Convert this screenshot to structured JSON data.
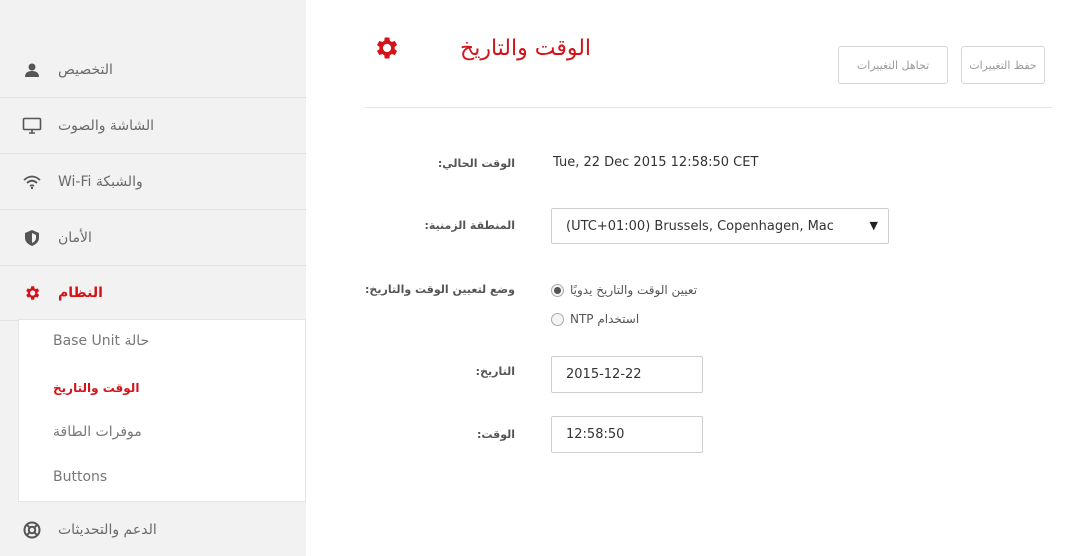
{
  "sidebar": {
    "items": [
      {
        "label": "التخصيص",
        "icon": "person-icon"
      },
      {
        "label": "الشاشة والصوت",
        "icon": "monitor-icon"
      },
      {
        "label": "Wi-Fi والشبكة",
        "icon": "wifi-icon"
      },
      {
        "label": "الأمان",
        "icon": "shield-icon"
      },
      {
        "label": "النظام",
        "icon": "gear-icon"
      },
      {
        "label": "الدعم والتحديثات",
        "icon": "lifebuoy-icon"
      }
    ],
    "submenu": [
      {
        "label": "Base Unit حالة"
      },
      {
        "label": "الوقت والتاريخ"
      },
      {
        "label": "موفرات الطاقة"
      },
      {
        "label": "Buttons"
      }
    ]
  },
  "main": {
    "title": "الوقت والتاريخ",
    "buttons": {
      "discard": "تجاهل التغييرات",
      "save": "حفظ التغييرات"
    },
    "current_time": {
      "label": ":الوقت الحالي",
      "value": "Tue, 22 Dec 2015 12:58:50 CET"
    },
    "timezone": {
      "label": ":المنطقة الزمنية",
      "value": "(UTC+01:00) Brussels, Copenhagen, Mac"
    },
    "mode": {
      "label": ":وضع لتعيين الوقت والتاريخ",
      "options": [
        "تعيين الوقت والتاريخ يدويًا",
        "NTP استخدام"
      ],
      "selected_index": 0
    },
    "date": {
      "label": ":التاريخ",
      "value": "2015-12-22"
    },
    "time": {
      "label": ":الوقت",
      "value": "12:58:50"
    }
  },
  "colors": {
    "accent": "#d3121a",
    "sidebar_bg": "#f2f2f2"
  }
}
